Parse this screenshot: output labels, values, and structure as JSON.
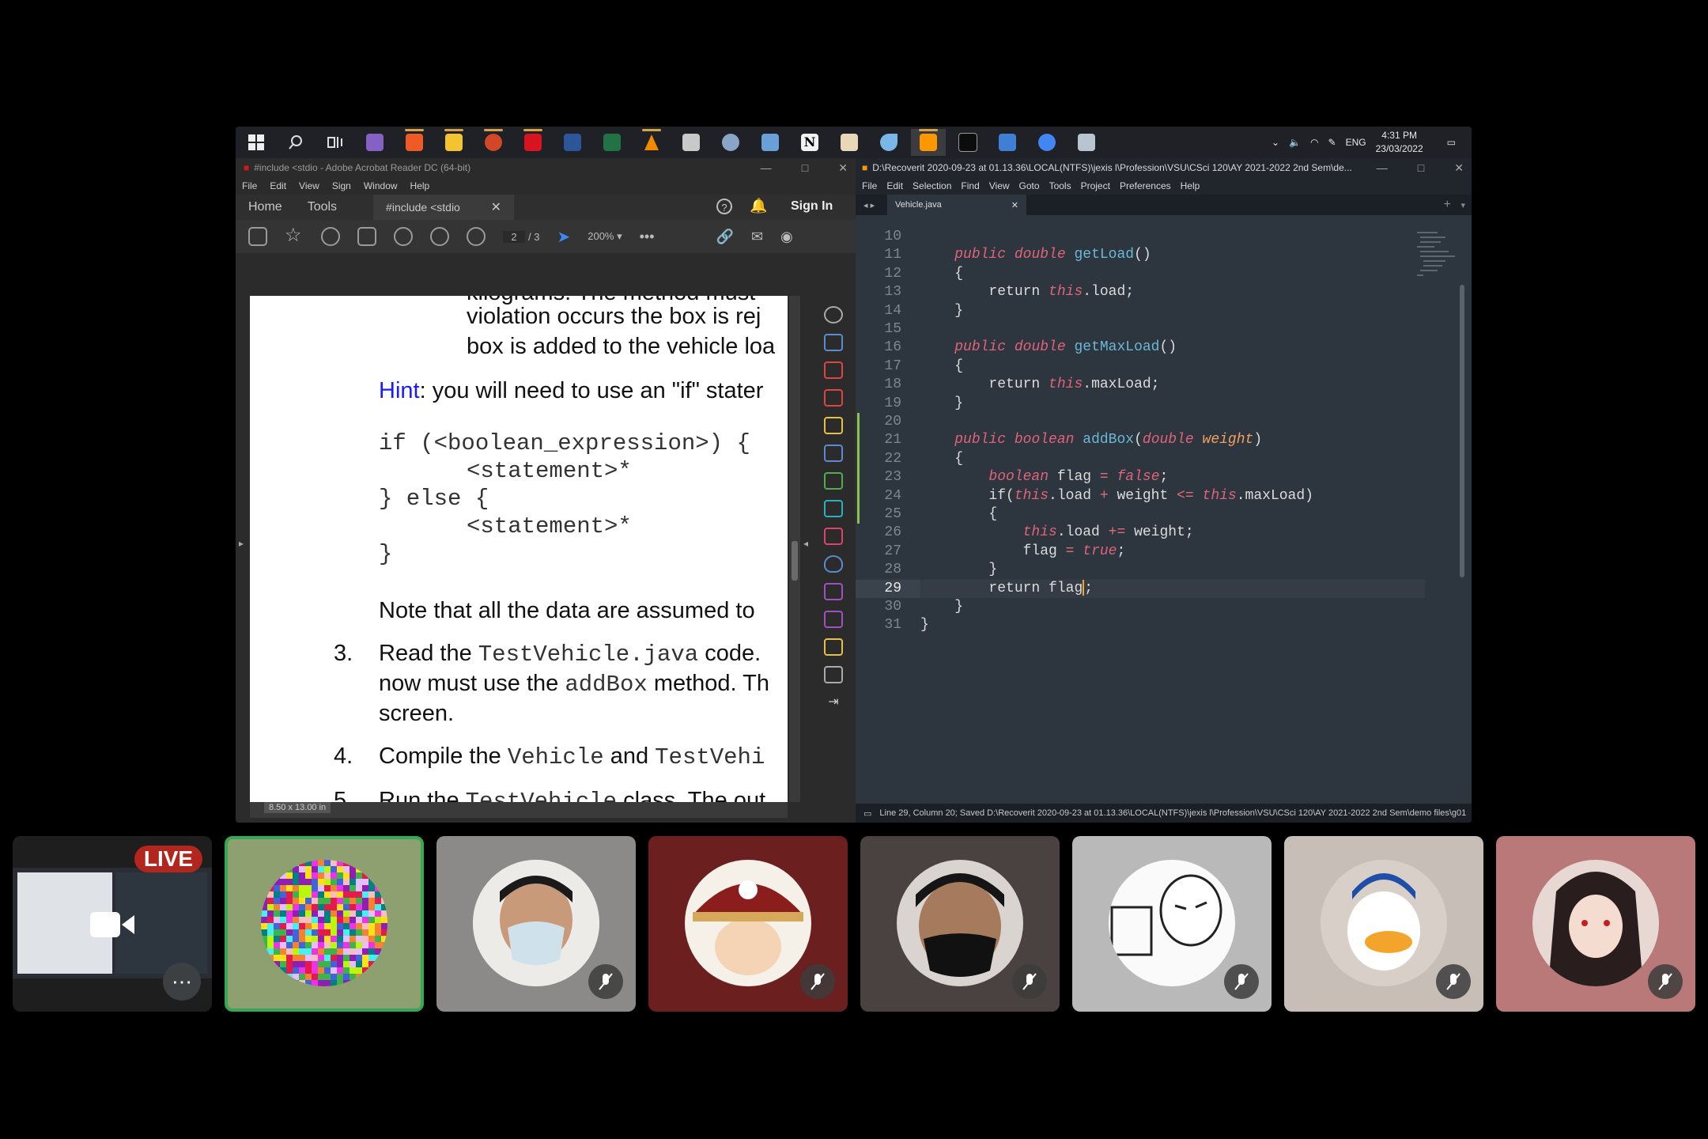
{
  "taskbar": {
    "time": "4:31 PM",
    "date": "23/03/2022",
    "lang": "ENG",
    "icons": [
      "start-icon",
      "search-icon",
      "task-view-icon",
      "visual-studio-icon",
      "brave-icon",
      "file-explorer-icon",
      "powerpoint-icon",
      "acrobat-icon",
      "word-icon",
      "excel-icon",
      "vlc-icon",
      "app-icon",
      "app-icon-2",
      "app-icon-3",
      "notion-icon",
      "photo-icon",
      "app-icon-4",
      "sublime-icon",
      "terminal-icon",
      "app-icon-5",
      "chrome-icon",
      "calculator-icon"
    ]
  },
  "acrobat": {
    "title": "#include <stdio - Adobe Acrobat Reader DC (64-bit)",
    "menu": [
      "File",
      "Edit",
      "View",
      "Sign",
      "Window",
      "Help"
    ],
    "tab_home": "Home",
    "tab_tools": "Tools",
    "tab_doc": "#include <stdio",
    "sign_in": "Sign In",
    "page_current": "2",
    "page_total": "/ 3",
    "zoom": "200%",
    "page_size": "8.50 x 13.00 in",
    "page": {
      "l0": "kilograms.  The method must",
      "l1": "violation occurs the box is rej",
      "l2": "box is added to the vehicle loa",
      "hint_label": "Hint",
      "hint_rest": ": you will need to use an \"if\" stater",
      "c1": "if (<boolean_expression>) {",
      "c2": "<statement>*",
      "c3": "} else {",
      "c4": "<statement>*",
      "c5": "}",
      "note": "Note that all the data are assumed to",
      "n3": "3.",
      "s3a": "Read the ",
      "s3b": "TestVehicle.java",
      "s3c": " code.",
      "s3d": "now must use the ",
      "s3e": "addBox",
      "s3f": " method. Th",
      "s3g": "screen.",
      "n4": "4.",
      "s4a": "Compile the ",
      "s4b": "Vehicle",
      "s4c": " and ",
      "s4d": "TestVehi",
      "n5": "5.",
      "s5a": "Run the ",
      "s5b": "TestVehicle",
      "s5c": " class. The out"
    }
  },
  "sublime": {
    "title": "D:\\Recoverit 2020-09-23 at 01.13.36\\LOCAL(NTFS)\\jexis l\\Profession\\VSU\\CSci 120\\AY 2021-2022 2nd Sem\\de...",
    "menu": [
      "File",
      "Edit",
      "Selection",
      "Find",
      "View",
      "Goto",
      "Tools",
      "Project",
      "Preferences",
      "Help"
    ],
    "tab": "Vehicle.java",
    "status": "Line 29, Column 20; Saved D:\\Recoverit 2020-09-23 at 01.13.36\\LOCAL(NTFS)\\jexis l\\Profession\\VSU\\CSci 120\\AY 2021-2022 2nd Sem\\demo files\\g01",
    "lines": {
      "n10": "10",
      "n11": "11",
      "n12": "12",
      "n13": "13",
      "n14": "14",
      "n15": "15",
      "n16": "16",
      "n17": "17",
      "n18": "18",
      "n19": "19",
      "n20": "20",
      "n21": "21",
      "n22": "22",
      "n23": "23",
      "n24": "24",
      "n25": "25",
      "n26": "26",
      "n27": "27",
      "n28": "28",
      "n29": "29",
      "n30": "30",
      "n31": "31"
    },
    "code": {
      "public": "public",
      "double": "double",
      "boolean": "boolean",
      "this": "this",
      "false": "false",
      "true": "true",
      "getLoad": "getLoad",
      "getMaxLoad": "getMaxLoad",
      "addBox": "addBox",
      "weight": "weight",
      "paren": "()",
      "open": "{",
      "close": "}",
      "return": "return",
      "load_semi": ".load;",
      "maxload_semi": ".maxLoad;",
      "flag_decl": " flag ",
      "eq": "=",
      "semi": ";",
      "if_open": "if(",
      "load": ".load ",
      "plus": "+",
      "weight_sp": " weight ",
      "lte": "<=",
      "maxload_close": ".maxLoad)",
      "pluseq": "+=",
      "weight_semi": " weight;",
      "flag_assign": "flag ",
      "return_flag": "return flag",
      "lparen": "(",
      "rparen": ")"
    }
  },
  "meeting": {
    "live": "LIVE",
    "more": "⋯",
    "tiles": [
      {
        "name": "presenter-tile",
        "bg": "#1e1e1e"
      },
      {
        "name": "participant-tile-pixel",
        "bg": "#8fa070"
      },
      {
        "name": "participant-tile-mask-white",
        "bg": "#8c8a88"
      },
      {
        "name": "participant-tile-pirate",
        "bg": "#6b1f1f"
      },
      {
        "name": "participant-tile-mask-black",
        "bg": "#4a4241"
      },
      {
        "name": "participant-tile-meme",
        "bg": "#b9b9b9"
      },
      {
        "name": "participant-tile-duck",
        "bg": "#c8beb8"
      },
      {
        "name": "participant-tile-anime",
        "bg": "#b97978"
      }
    ]
  }
}
